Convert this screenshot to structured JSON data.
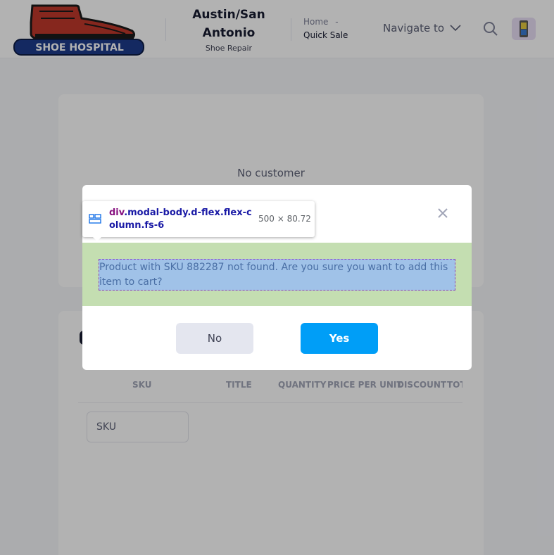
{
  "header": {
    "logo_text": "SHOE HOSPITAL",
    "store_name": "Austin/San Antonio",
    "store_type": "Shoe Repair",
    "breadcrumb_home": "Home",
    "breadcrumb_sep": "-",
    "breadcrumb_current": "Quick Sale",
    "navigate_label": "Navigate to"
  },
  "customer_card": {
    "empty_text": "No customer"
  },
  "cart_table": {
    "columns": [
      "SKU",
      "TITLE",
      "QUANTITY",
      "PRICE PER UNIT",
      "DISCOUNT",
      "TOT"
    ],
    "sku_placeholder": "SKU"
  },
  "modal": {
    "message": "Product with SKU 882287 not found. Are you sure you want to add this item to cart?",
    "no_label": "No",
    "yes_label": "Yes"
  },
  "devtools_tooltip": {
    "tag": "div",
    "selector": ".modal-body.d-flex.flex-column.fs-6",
    "size": "500 × 80.72"
  },
  "colors": {
    "primary": "#009ef7",
    "secondary_button": "#e4e6ef",
    "highlight_padding": "#c4deb1",
    "highlight_content": "#a0c2e8"
  }
}
